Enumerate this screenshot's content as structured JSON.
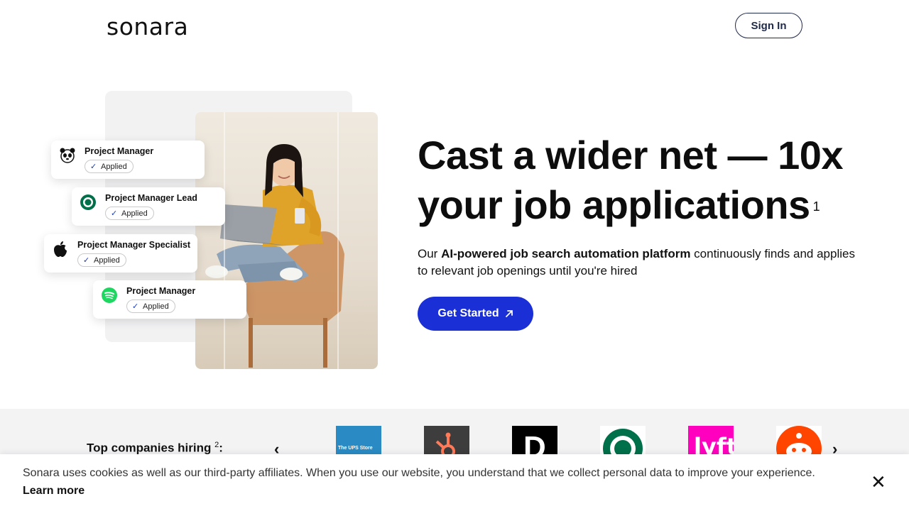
{
  "header": {
    "logo_text": "sonara",
    "signin_label": "Sign In"
  },
  "hero": {
    "headline_line1": "Cast a wider net — 10x",
    "headline_line2": "your job applications",
    "headline_footnote": "1",
    "sub_pre": "Our ",
    "sub_bold": "AI-powered job search automation platform",
    "sub_post": " continuously finds and applies to relevant job openings until you're hired",
    "cta_label": "Get Started",
    "cta_icon": "arrow-up-right-icon"
  },
  "application_cards": [
    {
      "company_icon": "panda-icon",
      "title": "Project Manager",
      "status": "Applied"
    },
    {
      "company_icon": "starbucks-icon",
      "title": "Project Manager Lead",
      "status": "Applied"
    },
    {
      "company_icon": "apple-icon",
      "title": "Project Manager Specialist",
      "status": "Applied"
    },
    {
      "company_icon": "spotify-icon",
      "title": "Project Manager",
      "status": "Applied"
    }
  ],
  "companies": {
    "label": "Top companies hiring",
    "footnote": "2",
    "suffix": ":",
    "logos": [
      {
        "name": "The UPS Store",
        "icon": "ups-store-icon",
        "color": "#2a8bc4"
      },
      {
        "name": "HubSpot",
        "icon": "hubspot-icon",
        "color": "#3d3d3d"
      },
      {
        "name": "DoorDash",
        "icon": "doordash-icon",
        "color": "#000000"
      },
      {
        "name": "Starbucks",
        "icon": "starbucks-icon",
        "color": "#00704a"
      },
      {
        "name": "Lyft",
        "icon": "lyft-icon",
        "color": "#ff00bf"
      },
      {
        "name": "Reddit",
        "icon": "reddit-icon",
        "color": "#ff4500"
      }
    ]
  },
  "cookie": {
    "text": "Sonara uses cookies as well as our third-party affiliates. When you use our website, you understand that we collect personal data to improve your experience.",
    "learn_more": "Learn more"
  },
  "colors": {
    "accent": "#1a2fd6",
    "text": "#0d0d0d",
    "strip_bg": "#f3f3f4"
  }
}
